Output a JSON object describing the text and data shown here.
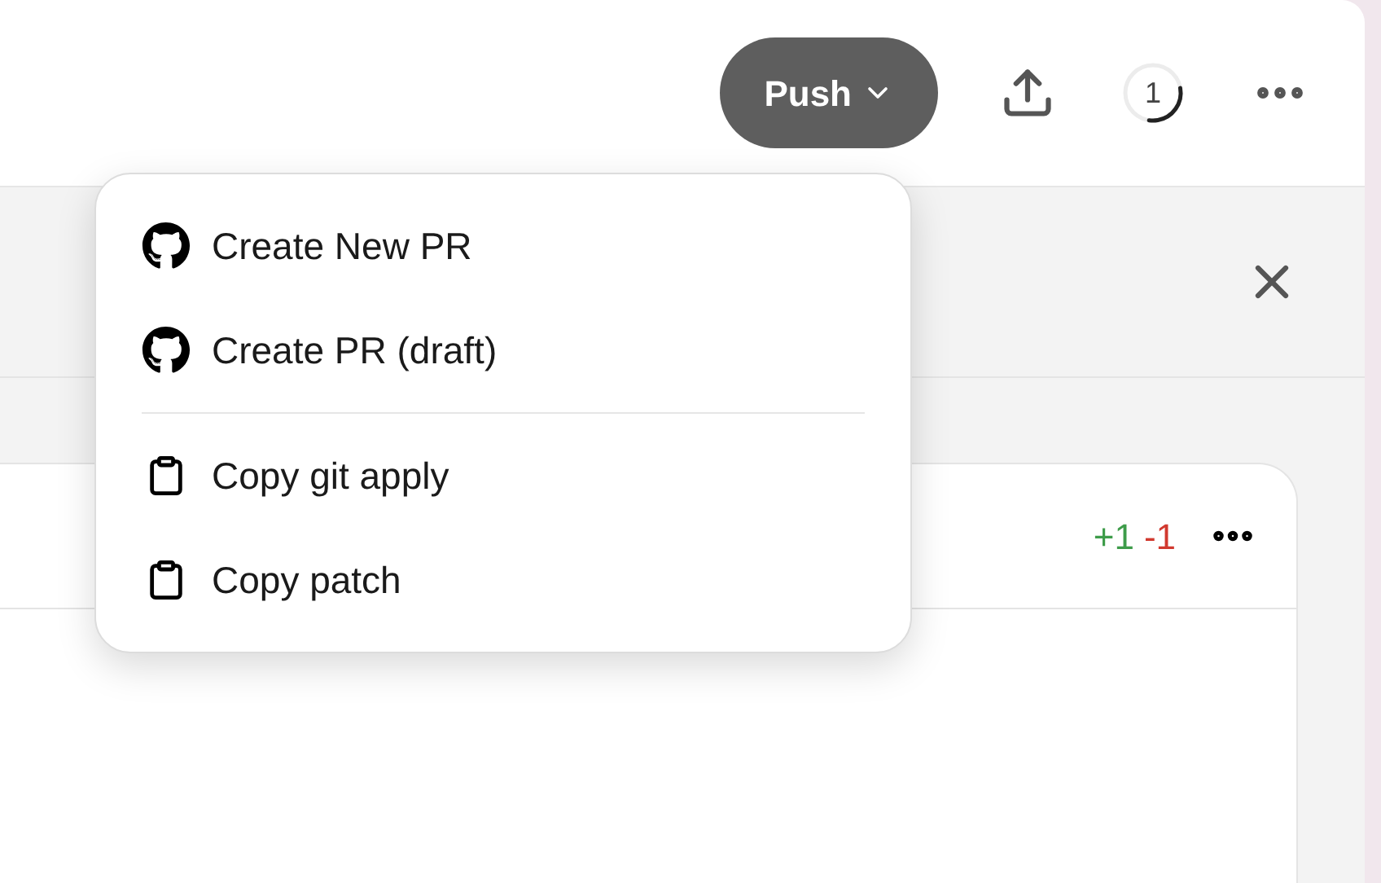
{
  "toolbar": {
    "push_button": {
      "label": "Push"
    },
    "progress": {
      "reading": "1"
    }
  },
  "diff_card": {
    "additions": "+1",
    "deletions": "-1"
  },
  "menu": {
    "groups": [
      {
        "items": [
          {
            "kind": "github",
            "label": "Create New PR"
          },
          {
            "kind": "github",
            "label": "Create PR (draft)"
          }
        ]
      },
      {
        "items": [
          {
            "kind": "clipboard",
            "label": "Copy git apply"
          },
          {
            "kind": "clipboard",
            "label": "Copy patch"
          }
        ]
      }
    ]
  }
}
